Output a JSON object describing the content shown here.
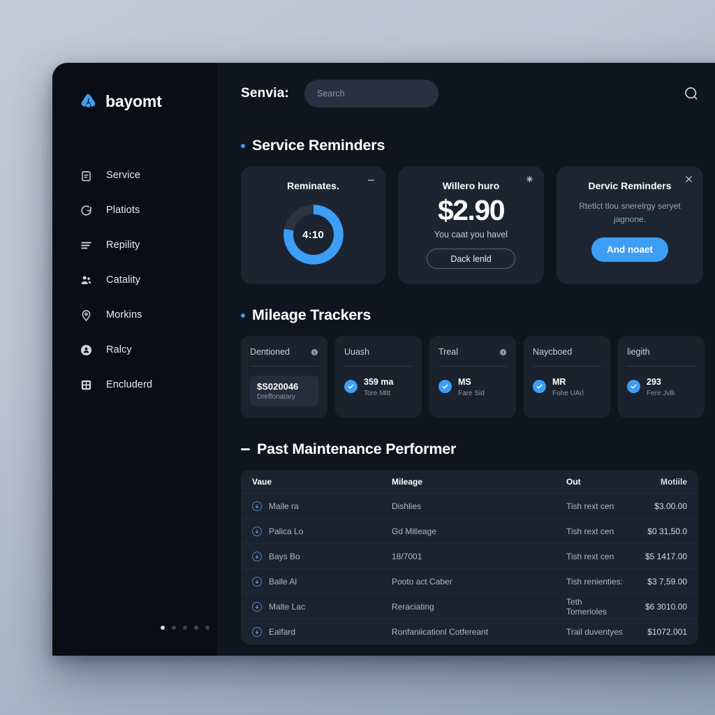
{
  "brand": {
    "name": "bayomt",
    "mark": "cloud-triangle-logo",
    "accent": "#3d9ef5"
  },
  "sidebar": {
    "items": [
      {
        "label": "Service",
        "icon": "clipboard-icon"
      },
      {
        "label": "Platiots",
        "icon": "refresh-circle-icon"
      },
      {
        "label": "Repility",
        "icon": "list-lines-icon"
      },
      {
        "label": "Catality",
        "icon": "people-icon"
      },
      {
        "label": "Morkins",
        "icon": "map-pin-icon"
      },
      {
        "label": "Ralcy",
        "icon": "user-circle-filled-icon"
      },
      {
        "label": "Encluderd",
        "icon": "grid-box-icon"
      }
    ],
    "pager": {
      "count": 5,
      "active": 0
    }
  },
  "topbar": {
    "title": "Senvia:",
    "search_value": "",
    "search_placeholder": "Search",
    "actions": [
      {
        "name": "search-icon"
      },
      {
        "name": "user-account-icon"
      }
    ]
  },
  "sections": {
    "reminders": {
      "title": "Service Reminders",
      "marker": "bullet"
    },
    "mileage": {
      "title": "Mileage Trackers",
      "marker": "bullet"
    },
    "maintenance": {
      "title": "Past Maintenance Performer",
      "marker": "dash"
    }
  },
  "reminder_cards": {
    "timer": {
      "title": "Reminates.",
      "corner_icon": "minimize-icon",
      "donut": {
        "value": "4:10",
        "percent": 78,
        "track_color": "#2b3442",
        "fill_color": "#3d9ef5"
      }
    },
    "price": {
      "title": "Willero huro",
      "corner_icon": "sparkle-icon",
      "amount": "$2.90",
      "subtitle": "You caat you havel",
      "button": "Dack lenld"
    },
    "dialog": {
      "title": "Dervic Reminders",
      "close_icon": "close-icon",
      "body": "Rtetlct tlou snerelrgy seryet jagnone.",
      "button": "And noaet"
    }
  },
  "mileage_cards": [
    {
      "title": "Dentioned",
      "info_icon": "info-icon",
      "chip": true,
      "value": "$S020046",
      "sub": "Dreffonatary"
    },
    {
      "title": "Uuash",
      "info_icon": null,
      "chip": false,
      "value": "359 ma",
      "sub": "Tore Mltt"
    },
    {
      "title": "Treal",
      "info_icon": "info-icon",
      "chip": false,
      "value": "MS",
      "sub": "Fare Sid"
    },
    {
      "title": "Naycboed",
      "info_icon": null,
      "chip": false,
      "value": "MR",
      "sub": "Fohe UArl"
    },
    {
      "title": "liegith",
      "info_icon": null,
      "chip": false,
      "value": "293",
      "sub": "Fere Jvlli"
    }
  ],
  "maintenance_table": {
    "columns": [
      "Vaue",
      "Mileage",
      "Out",
      "Motiile"
    ],
    "rows": [
      {
        "icon": "circle-arrow-icon",
        "name": "Maile ra",
        "mileage": "Dishlies",
        "out": "Tish rext cen",
        "amount": "$3.00.00"
      },
      {
        "icon": "circle-arrow-icon",
        "name": "Palica Lo",
        "mileage": "Gd Milleage",
        "out": "Tish rext cen",
        "amount": "$0 31,50.0"
      },
      {
        "icon": "circle-arrow-icon",
        "name": "Bays Bo",
        "mileage": "18/7001",
        "out": "Tish rext cen",
        "amount": "$5 1417.00"
      },
      {
        "icon": "circle-arrow-icon",
        "name": "Balle Al",
        "mileage": "Pooto act Caber",
        "out": "Tish renienties:",
        "amount": "$3 7,59.00"
      },
      {
        "icon": "circle-arrow-icon",
        "name": "Malte Lac",
        "mileage": "Reraciating",
        "out": "Teth Tomerioles",
        "amount": "$6 3010.00"
      },
      {
        "icon": "circle-arrow-icon",
        "name": "Ealfard",
        "mileage": "Ronfaniicationl Cotfereant",
        "out": "Trail duventyes",
        "amount": "$1072.001"
      }
    ]
  }
}
